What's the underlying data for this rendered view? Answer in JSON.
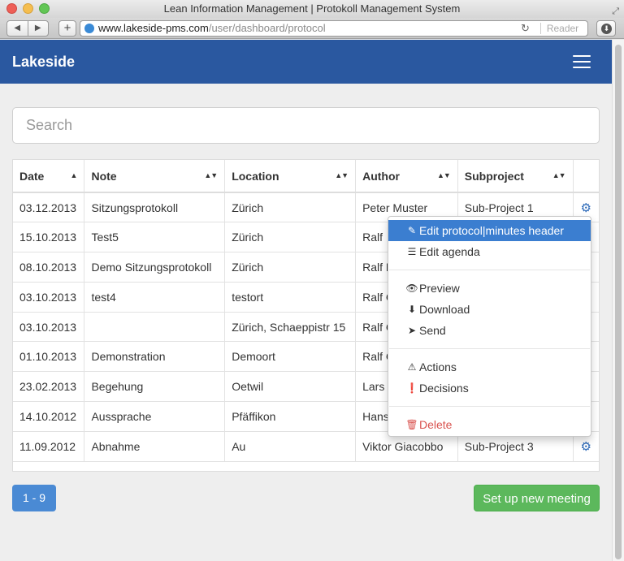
{
  "window": {
    "title": "Lean Information Management | Protokoll Management System",
    "nav_back": "◀",
    "nav_forward": "▶",
    "new_tab": "+",
    "url_host": "www.lakeside-pms.com",
    "url_path": "/user/dashboard/protocol",
    "reader_label": "Reader"
  },
  "app": {
    "brand": "Lakeside",
    "accent_color": "#2a58a0"
  },
  "search": {
    "placeholder": "Search"
  },
  "table": {
    "columns": [
      "Date",
      "Note",
      "Location",
      "Author",
      "Subproject"
    ],
    "rows": [
      {
        "date": "03.12.2013",
        "note": "Sitzungsprotokoll",
        "location": "Zürich",
        "author": "Peter Muster",
        "subproject": "Sub-Project 1"
      },
      {
        "date": "15.10.2013",
        "note": "Test5",
        "location": "Zürich",
        "author": "Ralf",
        "subproject": ""
      },
      {
        "date": "08.10.2013",
        "note": "Demo Sitzungsprotokoll",
        "location": "Zürich",
        "author": "Ralf K",
        "subproject": ""
      },
      {
        "date": "03.10.2013",
        "note": "test4",
        "location": "testort",
        "author": "Ralf C",
        "subproject": ""
      },
      {
        "date": "03.10.2013",
        "note": "",
        "location": "Zürich, Schaeppistr 15",
        "author": "Ralf C",
        "subproject": ""
      },
      {
        "date": "01.10.2013",
        "note": "Demonstration",
        "location": "Demoort",
        "author": "Ralf C",
        "subproject": ""
      },
      {
        "date": "23.02.2013",
        "note": "Begehung",
        "location": "Oetwil",
        "author": "Lars V",
        "subproject": ""
      },
      {
        "date": "14.10.2012",
        "note": "Aussprache",
        "location": "Pfäffikon",
        "author": "Hans",
        "subproject": ""
      },
      {
        "date": "11.09.2012",
        "note": "Abnahme",
        "location": "Au",
        "author": "Viktor Giacobbo",
        "subproject": "Sub-Project 3"
      }
    ]
  },
  "dropdown": {
    "items": [
      {
        "icon": "pencil-icon",
        "label": "Edit protocol|minutes header",
        "active": true
      },
      {
        "icon": "list-icon",
        "label": "Edit agenda"
      },
      {
        "icon": "eye-icon",
        "label": "Preview"
      },
      {
        "icon": "download-icon",
        "label": "Download"
      },
      {
        "icon": "send-icon",
        "label": "Send"
      },
      {
        "icon": "warning-icon",
        "label": "Actions"
      },
      {
        "icon": "exclamation-icon",
        "label": "Decisions"
      },
      {
        "icon": "trash-icon",
        "label": "Delete",
        "danger": true
      }
    ]
  },
  "footer": {
    "pager_label": "1 - 9",
    "new_meeting_label": "Set up new meeting"
  }
}
